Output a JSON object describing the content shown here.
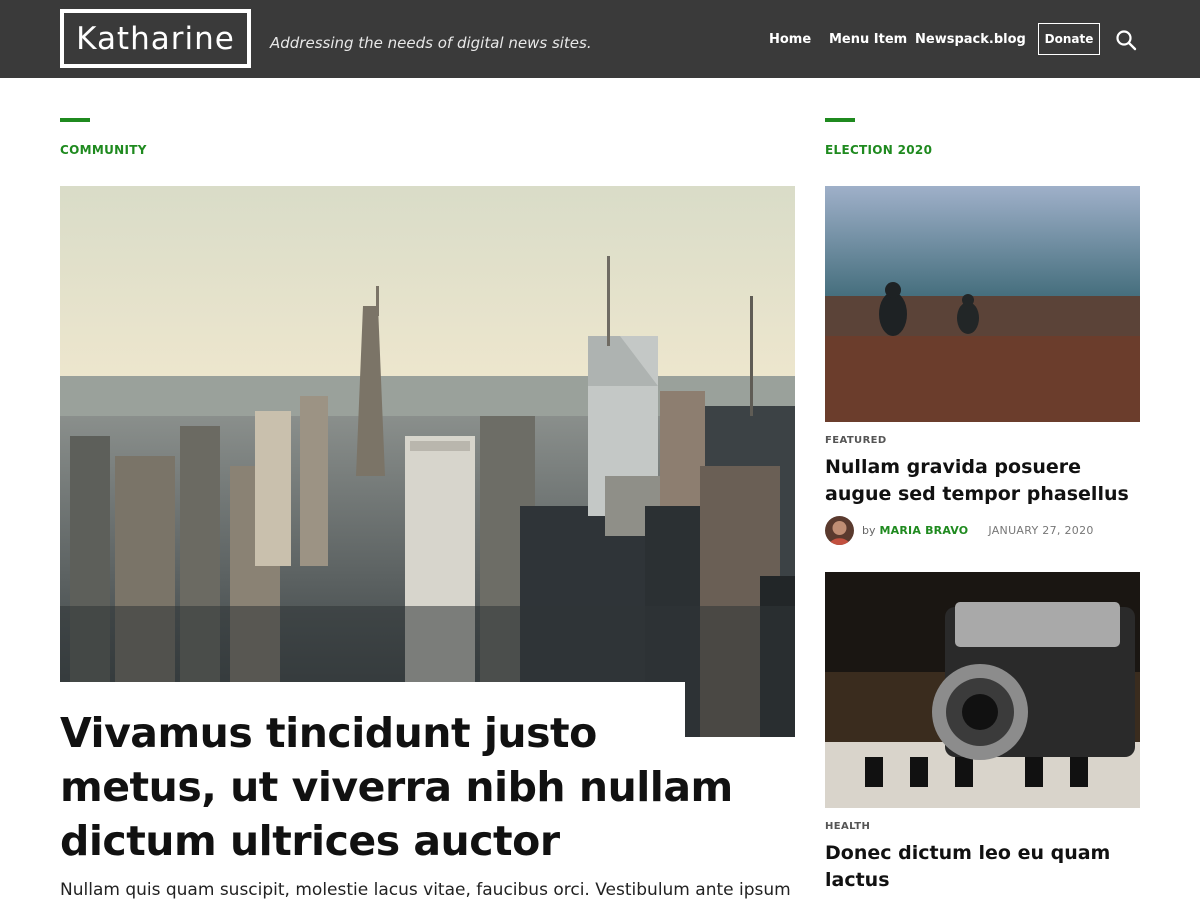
{
  "header": {
    "logo": "Katharine",
    "tagline": "Addressing the needs of digital news sites.",
    "nav": [
      "Home",
      "Menu Item",
      "Newspack.blog"
    ],
    "donate_label": "Donate",
    "search_icon": "search-icon"
  },
  "colors": {
    "header_bg": "#3a3a3a",
    "accent": "#1f8a1f",
    "text": "#111111"
  },
  "main": {
    "section_label": "COMMUNITY",
    "hero_title": "Vivamus tincidunt justo metus, ut viverra nibh nullam dictum ultrices auctor",
    "hero_excerpt": "Nullam quis quam suscipit, molestie lacus vitae, faucibus orci. Vestibulum ante ipsum"
  },
  "sidebar": {
    "section_label": "ELECTION 2020",
    "cards": [
      {
        "category": "FEATURED",
        "title": "Nullam gravida posuere augue sed tempor phasellus",
        "by": "by",
        "author": "MARIA BRAVO",
        "date": "JANUARY 27, 2020"
      },
      {
        "category": "HEALTH",
        "title": "Donec dictum leo eu quam lactus"
      }
    ]
  }
}
